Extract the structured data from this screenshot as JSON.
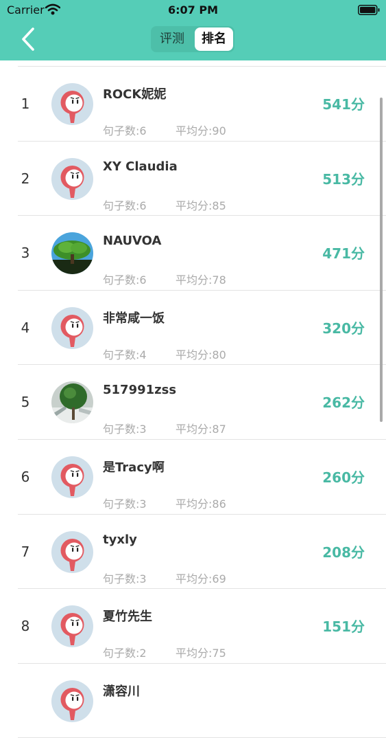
{
  "status_bar": {
    "carrier": "Carrier",
    "time": "6:07 PM"
  },
  "tabs": [
    {
      "label": "评测",
      "active": false
    },
    {
      "label": "排名",
      "active": true
    }
  ],
  "ranking": [
    {
      "rank": "1",
      "name": "ROCK妮妮",
      "sentences": "句子数:6",
      "average": "平均分:90",
      "score": "541分",
      "avatar": "robot"
    },
    {
      "rank": "2",
      "name": "XY Claudia",
      "sentences": "句子数:6",
      "average": "平均分:85",
      "score": "513分",
      "avatar": "robot"
    },
    {
      "rank": "3",
      "name": "NAUVOA",
      "sentences": "句子数:6",
      "average": "平均分:78",
      "score": "471分",
      "avatar": "tree"
    },
    {
      "rank": "4",
      "name": "非常咸一饭",
      "sentences": "句子数:4",
      "average": "平均分:80",
      "score": "320分",
      "avatar": "robot"
    },
    {
      "rank": "5",
      "name": "517991zss",
      "sentences": "句子数:3",
      "average": "平均分:87",
      "score": "262分",
      "avatar": "topiary"
    },
    {
      "rank": "6",
      "name": "是Tracy啊",
      "sentences": "句子数:3",
      "average": "平均分:86",
      "score": "260分",
      "avatar": "robot"
    },
    {
      "rank": "7",
      "name": "tyxly",
      "sentences": "句子数:3",
      "average": "平均分:69",
      "score": "208分",
      "avatar": "robot"
    },
    {
      "rank": "8",
      "name": "夏竹先生",
      "sentences": "句子数:2",
      "average": "平均分:75",
      "score": "151分",
      "avatar": "robot"
    },
    {
      "rank": "",
      "name": "潇容川",
      "sentences": "",
      "average": "",
      "score": "",
      "avatar": "robot"
    }
  ],
  "colors": {
    "header": "#55cdb7",
    "score": "#49b9a4"
  }
}
